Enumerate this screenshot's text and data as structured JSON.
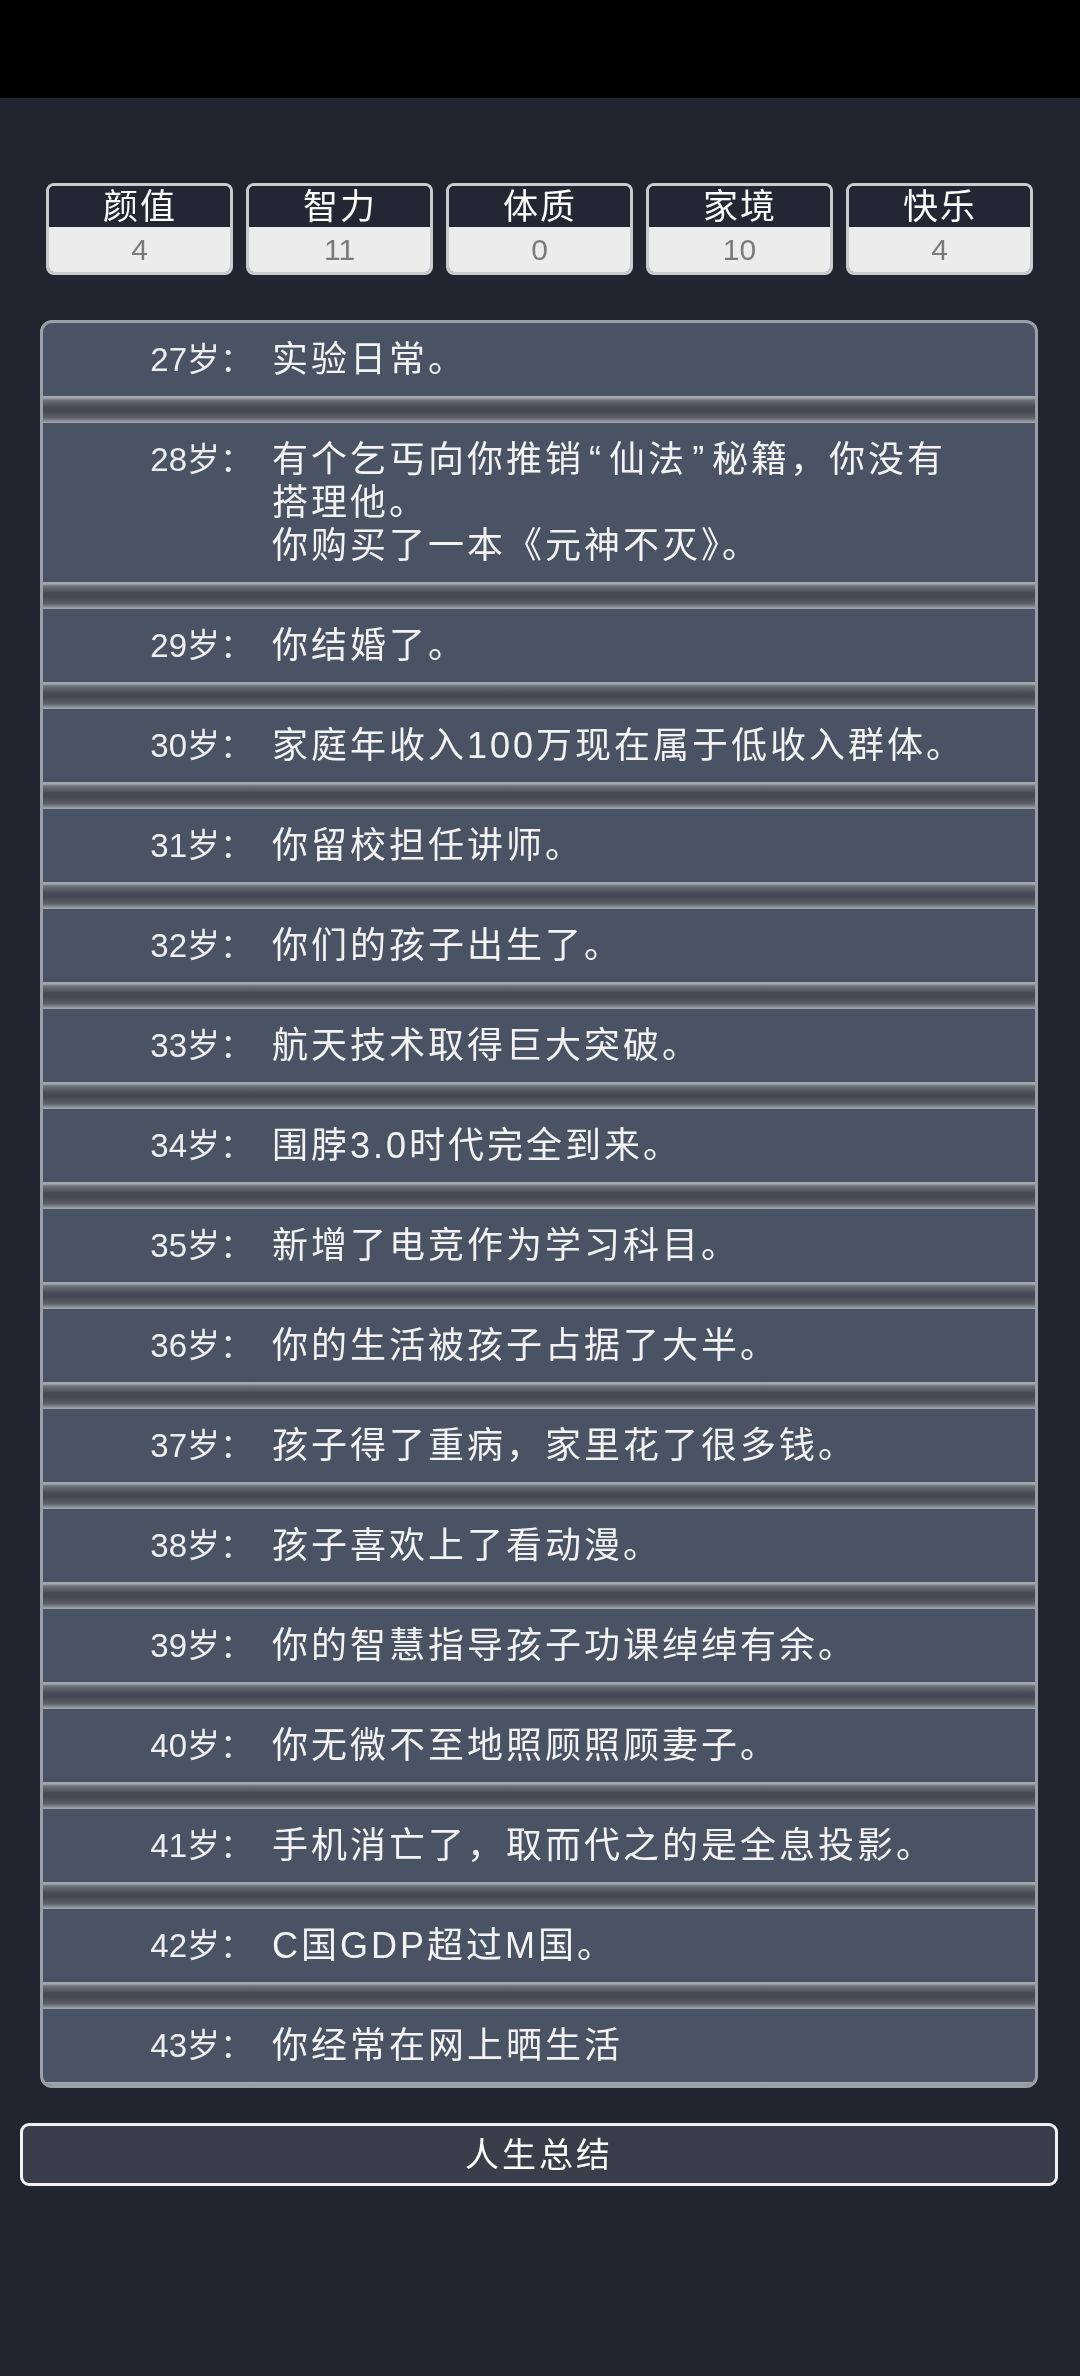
{
  "stats": [
    {
      "label": "颜值",
      "value": "4"
    },
    {
      "label": "智力",
      "value": "11"
    },
    {
      "label": "体质",
      "value": "0"
    },
    {
      "label": "家境",
      "value": "10"
    },
    {
      "label": "快乐",
      "value": "4"
    }
  ],
  "events": [
    {
      "age": "27岁：",
      "texts": [
        "实验日常。"
      ]
    },
    {
      "age": "28岁：",
      "texts": [
        "有个乞丐向你推销“仙法”秘籍，你没有搭理他。",
        "你购买了一本《元神不灭》。"
      ]
    },
    {
      "age": "29岁：",
      "texts": [
        "你结婚了。"
      ]
    },
    {
      "age": "30岁：",
      "texts": [
        "家庭年收入100万现在属于低收入群体。"
      ]
    },
    {
      "age": "31岁：",
      "texts": [
        "你留校担任讲师。"
      ]
    },
    {
      "age": "32岁：",
      "texts": [
        "你们的孩子出生了。"
      ]
    },
    {
      "age": "33岁：",
      "texts": [
        "航天技术取得巨大突破。"
      ]
    },
    {
      "age": "34岁：",
      "texts": [
        "围脖3.0时代完全到来。"
      ]
    },
    {
      "age": "35岁：",
      "texts": [
        "新增了电竞作为学习科目。"
      ]
    },
    {
      "age": "36岁：",
      "texts": [
        "你的生活被孩子占据了大半。"
      ]
    },
    {
      "age": "37岁：",
      "texts": [
        "孩子得了重病，家里花了很多钱。"
      ]
    },
    {
      "age": "38岁：",
      "texts": [
        "孩子喜欢上了看动漫。"
      ]
    },
    {
      "age": "39岁：",
      "texts": [
        "你的智慧指导孩子功课绰绰有余。"
      ]
    },
    {
      "age": "40岁：",
      "texts": [
        "你无微不至地照顾照顾妻子。"
      ]
    },
    {
      "age": "41岁：",
      "texts": [
        "手机消亡了，取而代之的是全息投影。"
      ]
    },
    {
      "age": "42岁：",
      "texts": [
        "C国GDP超过M国。"
      ]
    },
    {
      "age": "43岁：",
      "texts": [
        "你经常在网上晒生活"
      ]
    }
  ],
  "summary_button": "人生总结"
}
